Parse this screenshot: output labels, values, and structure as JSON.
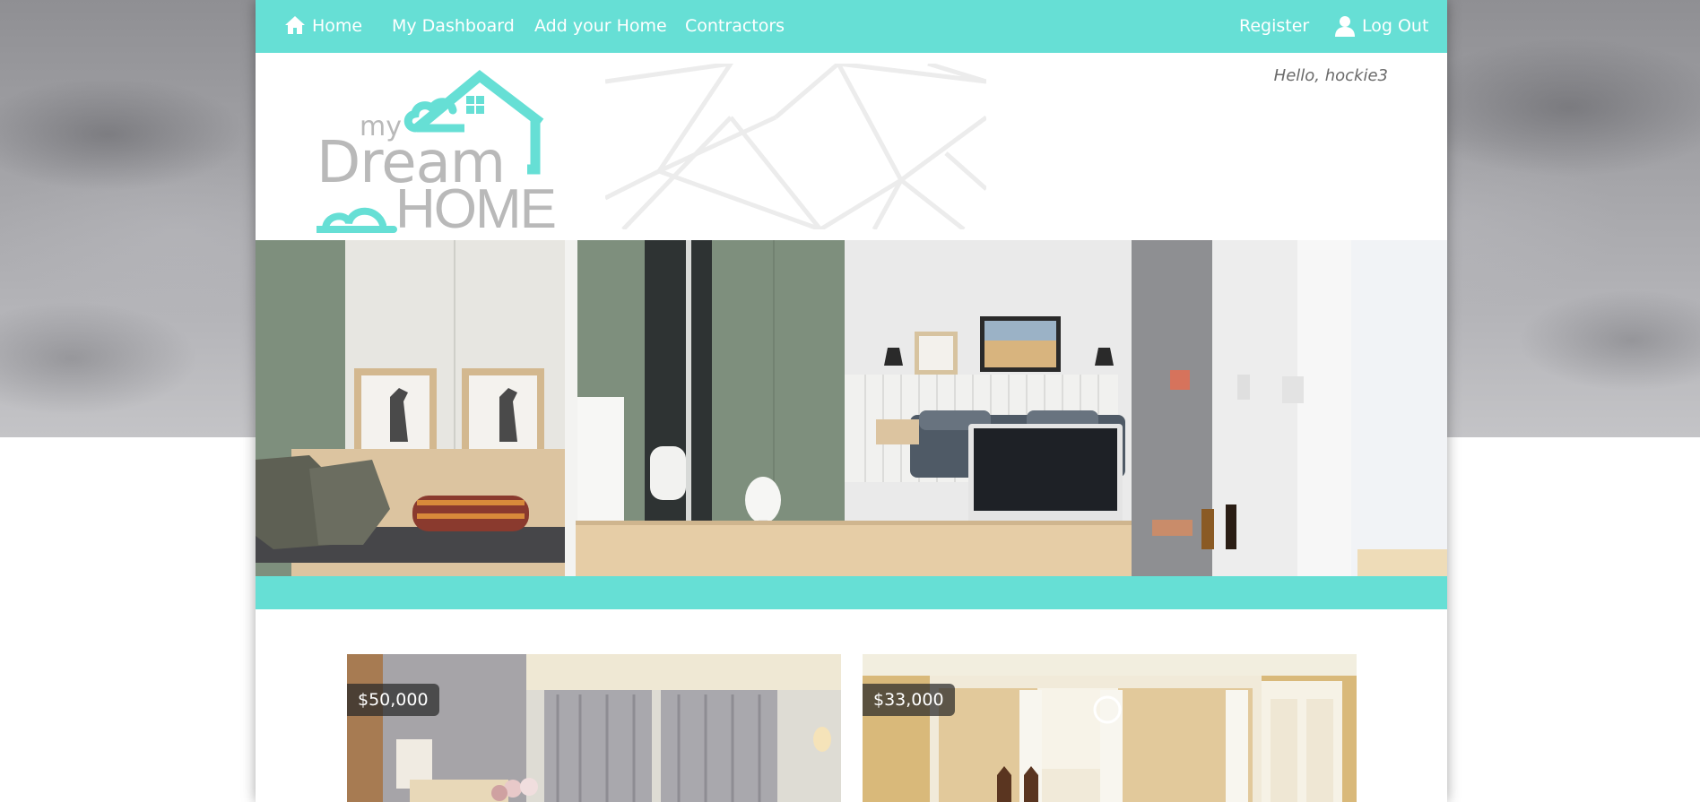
{
  "nav": {
    "home_label": "Home",
    "dashboard_label": "My Dashboard",
    "add_home_label": "Add your Home",
    "contractors_label": "Contractors",
    "register_label": "Register",
    "logout_label": "Log Out"
  },
  "header": {
    "greeting": "Hello, hockie3",
    "logo_text": {
      "my": "my",
      "dream": "Dream",
      "home": "HOME"
    }
  },
  "listings": [
    {
      "price": "$50,000"
    },
    {
      "price": "$33,000"
    }
  ],
  "colors": {
    "accent": "#66dfd5",
    "logo_gray": "#b9b9b9",
    "badge_bg": "#2e2e2e"
  },
  "icons": {
    "home": "house-icon",
    "logout": "user-icon"
  }
}
